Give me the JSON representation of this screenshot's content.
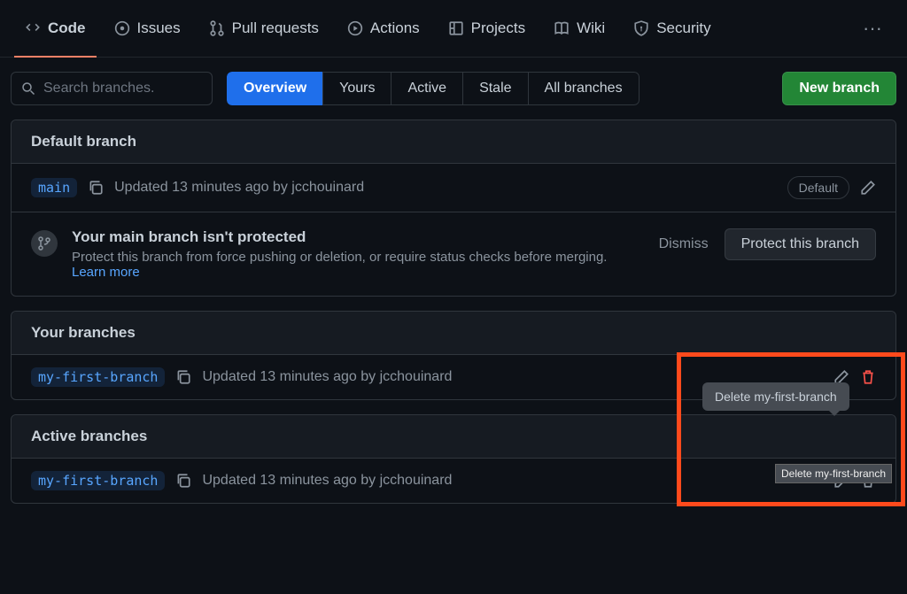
{
  "nav": {
    "code": "Code",
    "issues": "Issues",
    "pulls": "Pull requests",
    "actions": "Actions",
    "projects": "Projects",
    "wiki": "Wiki",
    "security": "Security"
  },
  "search": {
    "placeholder": "Search branches."
  },
  "filters": {
    "overview": "Overview",
    "yours": "Yours",
    "active": "Active",
    "stale": "Stale",
    "all": "All branches"
  },
  "new_branch_btn": "New branch",
  "default": {
    "header": "Default branch",
    "branch": "main",
    "update": "Updated 13 minutes ago by jcchouinard",
    "badge": "Default"
  },
  "warn": {
    "title": "Your main branch isn't protected",
    "desc": "Protect this branch from force pushing or deletion, or require status checks before merging. ",
    "learn_more": "Learn more",
    "dismiss": "Dismiss",
    "protect": "Protect this branch"
  },
  "yours": {
    "header": "Your branches",
    "branch": "my-first-branch",
    "update": "Updated 13 minutes ago by jcchouinard"
  },
  "active": {
    "header": "Active branches",
    "branch": "my-first-branch",
    "update": "Updated 13 minutes ago by jcchouinard"
  },
  "tooltip": "Delete my-first-branch",
  "native_tip": "Delete my-first-branch"
}
